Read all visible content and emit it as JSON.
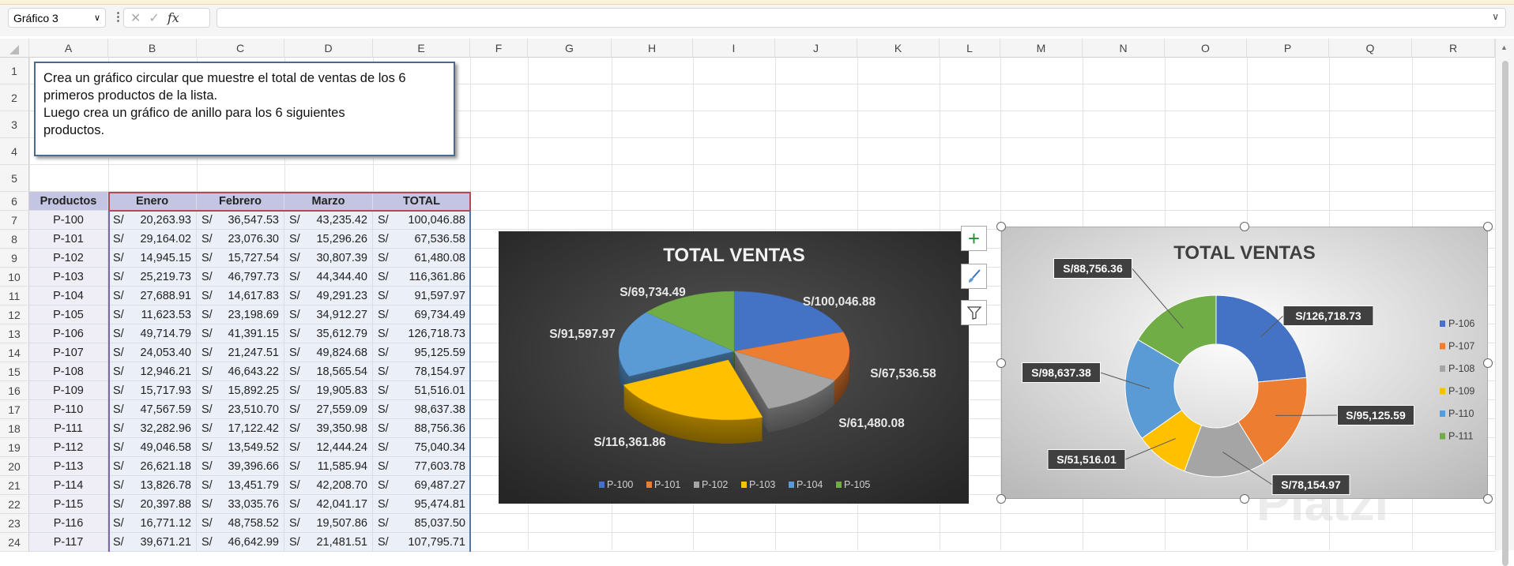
{
  "formula_bar": {
    "name_box": "Gráfico 3",
    "cancel_icon": "✕",
    "enter_icon": "✓",
    "fx_label": "fx",
    "formula": ""
  },
  "columns": [
    "A",
    "B",
    "C",
    "D",
    "E",
    "F",
    "G",
    "H",
    "I",
    "J",
    "K",
    "L",
    "M",
    "N",
    "O",
    "P",
    "Q",
    "R"
  ],
  "rows": [
    "1",
    "2",
    "3",
    "4",
    "5",
    "6",
    "7",
    "8",
    "9",
    "10",
    "11",
    "12",
    "13",
    "14",
    "15",
    "16",
    "17",
    "18",
    "19",
    "20",
    "21",
    "22",
    "23",
    "24"
  ],
  "note": {
    "lines": [
      "Crea un gráfico circular que muestre el total de ventas de los 6",
      "primeros productos de la lista.",
      "Luego crea un gráfico de anillo para los 6 siguientes",
      "productos."
    ]
  },
  "table": {
    "currency": "S/",
    "headers": [
      "Productos",
      "Enero",
      "Febrero",
      "Marzo",
      "TOTAL"
    ],
    "rows": [
      [
        "P-100",
        "20,263.93",
        "36,547.53",
        "43,235.42",
        "100,046.88"
      ],
      [
        "P-101",
        "29,164.02",
        "23,076.30",
        "15,296.26",
        "67,536.58"
      ],
      [
        "P-102",
        "14,945.15",
        "15,727.54",
        "30,807.39",
        "61,480.08"
      ],
      [
        "P-103",
        "25,219.73",
        "46,797.73",
        "44,344.40",
        "116,361.86"
      ],
      [
        "P-104",
        "27,688.91",
        "14,617.83",
        "49,291.23",
        "91,597.97"
      ],
      [
        "P-105",
        "11,623.53",
        "23,198.69",
        "34,912.27",
        "69,734.49"
      ],
      [
        "P-106",
        "49,714.79",
        "41,391.15",
        "35,612.79",
        "126,718.73"
      ],
      [
        "P-107",
        "24,053.40",
        "21,247.51",
        "49,824.68",
        "95,125.59"
      ],
      [
        "P-108",
        "12,946.21",
        "46,643.22",
        "18,565.54",
        "78,154.97"
      ],
      [
        "P-109",
        "15,717.93",
        "15,892.25",
        "19,905.83",
        "51,516.01"
      ],
      [
        "P-110",
        "47,567.59",
        "23,510.70",
        "27,559.09",
        "98,637.38"
      ],
      [
        "P-111",
        "32,282.96",
        "17,122.42",
        "39,350.98",
        "88,756.36"
      ],
      [
        "P-112",
        "49,046.58",
        "13,549.52",
        "12,444.24",
        "75,040.34"
      ],
      [
        "P-113",
        "26,621.18",
        "39,396.66",
        "11,585.94",
        "77,603.78"
      ],
      [
        "P-114",
        "13,826.78",
        "13,451.79",
        "42,208.70",
        "69,487.27"
      ],
      [
        "P-115",
        "20,397.88",
        "33,035.76",
        "42,041.17",
        "95,474.81"
      ],
      [
        "P-116",
        "16,771.12",
        "48,758.52",
        "19,507.86",
        "85,037.50"
      ],
      [
        "P-117",
        "39,671.21",
        "46,642.99",
        "21,481.51",
        "107,795.71"
      ]
    ]
  },
  "chart_tools": {
    "add": "+",
    "style": "brush",
    "filter": "filter"
  },
  "watermark": "Platzi",
  "chart_data": [
    {
      "type": "pie",
      "variant": "3d-exploded",
      "title": "TOTAL VENTAS",
      "categories": [
        "P-100",
        "P-101",
        "P-102",
        "P-103",
        "P-104",
        "P-105"
      ],
      "values": [
        100046.88,
        67536.58,
        61480.08,
        116361.86,
        91597.97,
        69734.49
      ],
      "labels": [
        "S/100,046.88",
        "S/67,536.58",
        "S/61,480.08",
        "S/116,361.86",
        "S/91,597.97",
        "S/69,734.49"
      ],
      "colors": [
        "#4472c4",
        "#ed7d31",
        "#a5a5a5",
        "#ffc000",
        "#5b9bd5",
        "#70ad47"
      ],
      "exploded": "P-103",
      "legend": "bottom",
      "background": "#3a3a3a"
    },
    {
      "type": "pie",
      "variant": "doughnut",
      "title": "TOTAL VENTAS",
      "categories": [
        "P-106",
        "P-107",
        "P-108",
        "P-109",
        "P-110",
        "P-111"
      ],
      "values": [
        126718.73,
        95125.59,
        78154.97,
        51516.01,
        98637.38,
        88756.36
      ],
      "labels": [
        "S/126,718.73",
        "S/95,125.59",
        "S/78,154.97",
        "S/51,516.01",
        "S/98,637.38",
        "S/88,756.36"
      ],
      "colors": [
        "#4472c4",
        "#ed7d31",
        "#a5a5a5",
        "#ffc000",
        "#5b9bd5",
        "#70ad47"
      ],
      "legend": "right",
      "background": "#e8e8e8"
    }
  ]
}
